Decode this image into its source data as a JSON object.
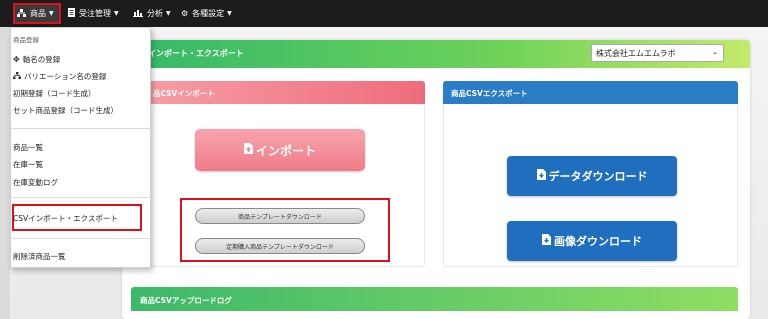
{
  "topnav": {
    "items": [
      {
        "label": "商品",
        "icon": "sitemap-icon"
      },
      {
        "label": "受注管理",
        "icon": "document-icon"
      },
      {
        "label": "分析",
        "icon": "bar-chart-icon"
      },
      {
        "label": "各種設定",
        "icon": "gear-icon"
      }
    ]
  },
  "dropdown": {
    "header": "商品登録",
    "group1": [
      "軸名の登録",
      "バリエーション名の登録",
      "初期登録（コード生成）",
      "セット商品登録（コード生成）"
    ],
    "group2": [
      "商品一覧",
      "在庫一覧",
      "在庫変動ログ"
    ],
    "group3": [
      "CSVインポート・エクスポート"
    ],
    "group4": [
      "削除済商品一覧"
    ]
  },
  "panel": {
    "title": "インポート・エクスポート",
    "company_select": "株式会社エムエムラボ"
  },
  "import_card": {
    "title": "品CSVインポート",
    "import_button": "インポート",
    "template_buttons": [
      "商品テンプレートダウンロード",
      "定期購入商品テンプレートダウンロード"
    ]
  },
  "export_card": {
    "title": "商品CSVエクスポート",
    "buttons": [
      "データダウンロード",
      "画像ダウンロード"
    ]
  },
  "log_card": {
    "title": "商品CSVアップロードログ"
  },
  "colors": {
    "accent_red": "#e0101a",
    "export_blue": "#1f6fbe",
    "import_pink": "#f07b88"
  }
}
